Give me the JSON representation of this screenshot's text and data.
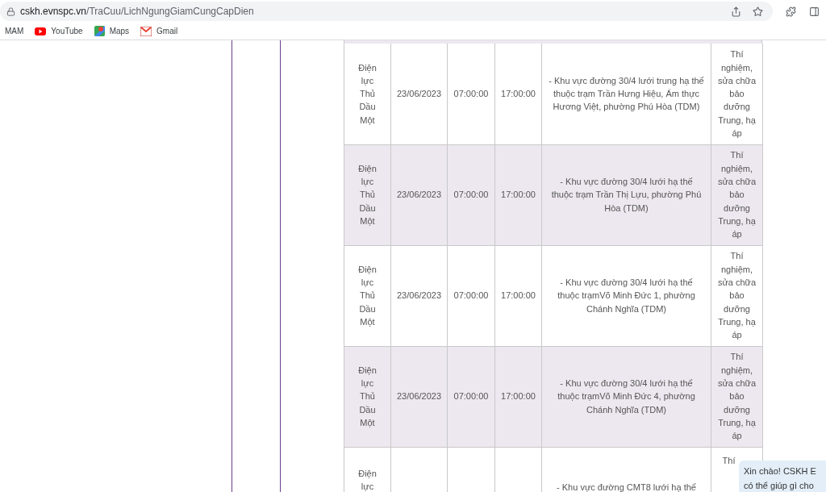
{
  "address_bar": {
    "domain": "cskh.evnspc.vn",
    "path": "/TraCuu/LichNgungGiamCungCapDien"
  },
  "bookmarks": [
    {
      "label": "MAM",
      "kind": "plain"
    },
    {
      "label": "YouTube",
      "kind": "youtube"
    },
    {
      "label": "Maps",
      "kind": "maps"
    },
    {
      "label": "Gmail",
      "kind": "gmail"
    }
  ],
  "rows": [
    {
      "unit": "Điện lực Thủ Dầu Một",
      "date": "23/06/2023",
      "start": "07:00:00",
      "end": "17:00:00",
      "description": "- Khu vực đường 30/4 lưới trung hạ thế thuộc trạm Trần Hưng Hiệu, Ẩm thực Hương Việt, phường Phú Hòa (TDM)",
      "reason": "Thí nghiệm, sửa chữa bảo dưỡng Trung, hạ áp"
    },
    {
      "unit": "Điện lực Thủ Dầu Một",
      "date": "23/06/2023",
      "start": "07:00:00",
      "end": "17:00:00",
      "description": "- Khu vực đường 30/4 lưới hạ thế thuộc trạm Trần Thị Lựu, phường Phú Hòa (TDM)",
      "reason": "Thí nghiệm, sửa chữa bảo dưỡng Trung, hạ áp"
    },
    {
      "unit": "Điện lực Thủ Dầu Một",
      "date": "23/06/2023",
      "start": "07:00:00",
      "end": "17:00:00",
      "description": "- Khu vực đường 30/4 lưới hạ thế thuộc trạmVõ Minh Đức 1, phường Chánh Nghĩa (TDM)",
      "reason": "Thí nghiệm, sửa chữa bảo dưỡng Trung, hạ áp"
    },
    {
      "unit": "Điện lực Thủ Dầu Một",
      "date": "23/06/2023",
      "start": "07:00:00",
      "end": "17:00:00",
      "description": "- Khu vực đường 30/4 lưới hạ thế thuộc trạmVõ Minh Đức 4, phường Chánh Nghĩa (TDM)",
      "reason": "Thí nghiệm, sửa chữa bảo dưỡng Trung, hạ áp"
    },
    {
      "unit": "Điện lực",
      "description": "- Khu vực đường CMT8 lưới hạ thế",
      "reason": "Thí"
    }
  ],
  "chat_bubble": {
    "lines": [
      "Xin chào! CSKH E",
      "có thể giúp gì cho"
    ]
  }
}
